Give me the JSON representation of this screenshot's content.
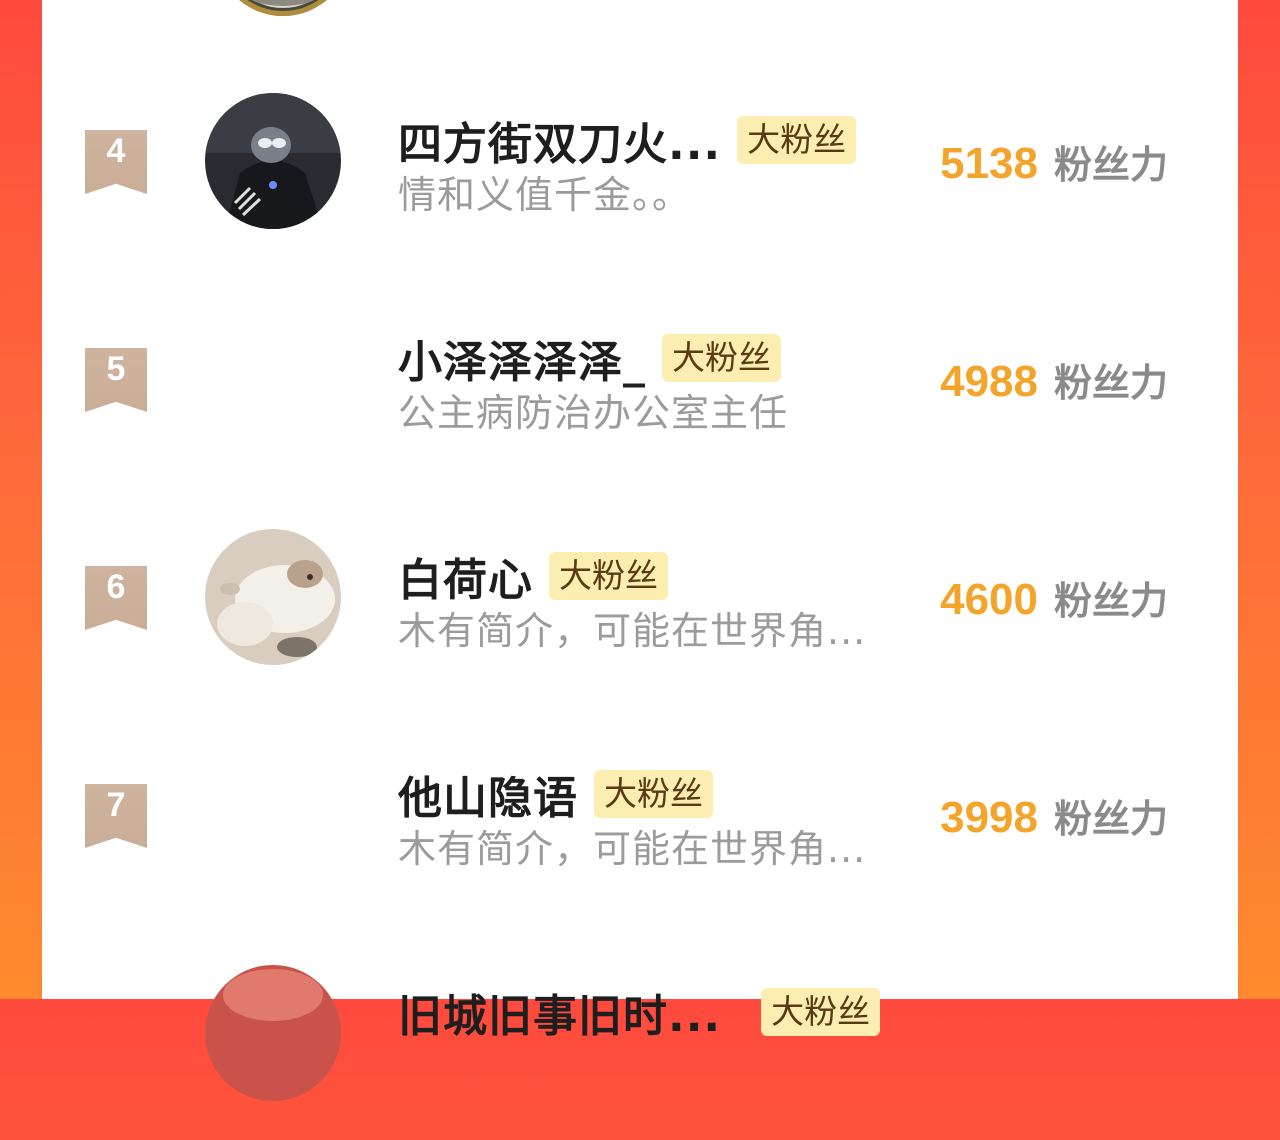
{
  "rows": [
    {
      "rank": "4",
      "name": "四方街双刀火...",
      "badge": "大粉丝",
      "bio": "情和义值千金。。",
      "score": "5138",
      "score_label": "粉丝力"
    },
    {
      "rank": "5",
      "name": "小泽泽泽泽_",
      "badge": "大粉丝",
      "bio": "公主病防治办公室主任",
      "score": "4988",
      "score_label": "粉丝力"
    },
    {
      "rank": "6",
      "name": "白荷心",
      "badge": "大粉丝",
      "bio": "木有简介，可能在世界角...",
      "score": "4600",
      "score_label": "粉丝力"
    },
    {
      "rank": "7",
      "name": "他山隐语",
      "badge": "大粉丝",
      "bio": "木有简介，可能在世界角...",
      "score": "3998",
      "score_label": "粉丝力"
    },
    {
      "rank": "",
      "name": "旧城旧事旧时...",
      "badge": "大粉丝",
      "bio": "",
      "score": "",
      "score_label": ""
    }
  ],
  "colors": {
    "background_gradient": [
      "#ff4a3d",
      "#ff8a2e"
    ],
    "score": "#f2a52a",
    "badge_bg": "#fbeeb0",
    "rank_ribbon": "#c9ad97"
  }
}
